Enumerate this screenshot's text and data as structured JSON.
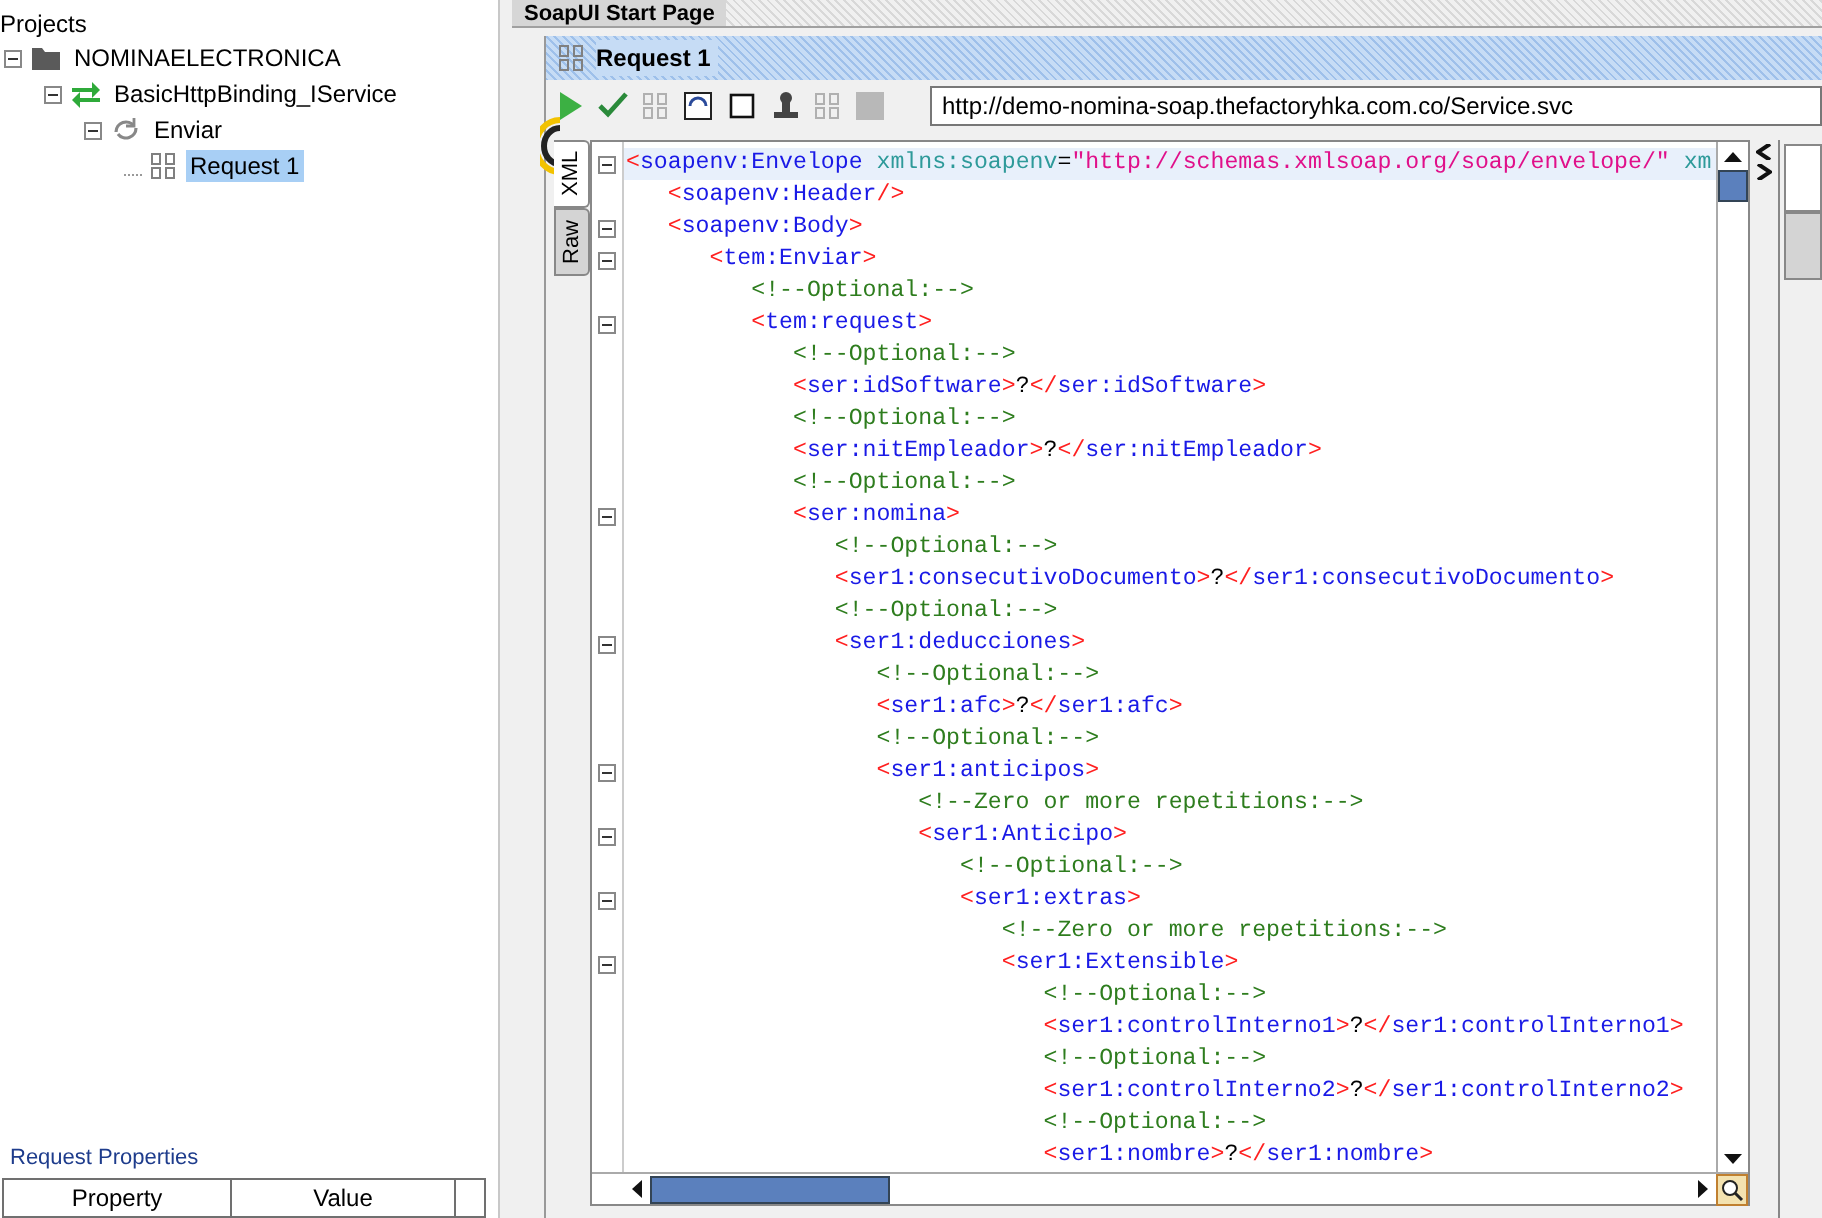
{
  "project_tree": {
    "title": "Projects",
    "items": [
      {
        "label": "NOMINAELECTRONICA",
        "kind": "project",
        "expanded": true,
        "selected": false,
        "children": [
          {
            "label": "BasicHttpBinding_IService",
            "kind": "interface",
            "expanded": true,
            "selected": false,
            "children": [
              {
                "label": "Enviar",
                "kind": "operation",
                "expanded": true,
                "selected": false,
                "children": [
                  {
                    "label": "Request 1",
                    "kind": "request",
                    "selected": true
                  }
                ]
              }
            ]
          }
        ]
      }
    ]
  },
  "request_properties": {
    "title": "Request Properties",
    "columns": [
      "Property",
      "Value"
    ]
  },
  "tabs": [
    {
      "label": "SoapUI Start Page",
      "selected": true
    }
  ],
  "request_window": {
    "title": "Request 1",
    "url": "http://demo-nomina-soap.thefactoryhka.com.co/Service.svc",
    "editor_tabs": [
      {
        "label": "XML",
        "selected": true
      },
      {
        "label": "Raw",
        "selected": false
      }
    ],
    "lines": [
      {
        "text": "<soapenv:Envelope xmlns:soapenv=\"http://schemas.xmlsoap.org/soap/envelope/\" xm",
        "foldable": true,
        "current": true
      },
      {
        "text": "   <soapenv:Header/>",
        "foldable": false,
        "current": false
      },
      {
        "text": "   <soapenv:Body>",
        "foldable": true,
        "current": false
      },
      {
        "text": "      <tem:Enviar>",
        "foldable": true,
        "current": false
      },
      {
        "text": "         <!--Optional:-->",
        "foldable": false,
        "current": false
      },
      {
        "text": "         <tem:request>",
        "foldable": true,
        "current": false
      },
      {
        "text": "            <!--Optional:-->",
        "foldable": false,
        "current": false
      },
      {
        "text": "            <ser:idSoftware>?</ser:idSoftware>",
        "foldable": false,
        "current": false
      },
      {
        "text": "            <!--Optional:-->",
        "foldable": false,
        "current": false
      },
      {
        "text": "            <ser:nitEmpleador>?</ser:nitEmpleador>",
        "foldable": false,
        "current": false
      },
      {
        "text": "            <!--Optional:-->",
        "foldable": false,
        "current": false
      },
      {
        "text": "            <ser:nomina>",
        "foldable": true,
        "current": false
      },
      {
        "text": "               <!--Optional:-->",
        "foldable": false,
        "current": false
      },
      {
        "text": "               <ser1:consecutivoDocumento>?</ser1:consecutivoDocumento>",
        "foldable": false,
        "current": false
      },
      {
        "text": "               <!--Optional:-->",
        "foldable": false,
        "current": false
      },
      {
        "text": "               <ser1:deducciones>",
        "foldable": true,
        "current": false
      },
      {
        "text": "                  <!--Optional:-->",
        "foldable": false,
        "current": false
      },
      {
        "text": "                  <ser1:afc>?</ser1:afc>",
        "foldable": false,
        "current": false
      },
      {
        "text": "                  <!--Optional:-->",
        "foldable": false,
        "current": false
      },
      {
        "text": "                  <ser1:anticipos>",
        "foldable": true,
        "current": false
      },
      {
        "text": "                     <!--Zero or more repetitions:-->",
        "foldable": false,
        "current": false
      },
      {
        "text": "                     <ser1:Anticipo>",
        "foldable": true,
        "current": false
      },
      {
        "text": "                        <!--Optional:-->",
        "foldable": false,
        "current": false
      },
      {
        "text": "                        <ser1:extras>",
        "foldable": true,
        "current": false
      },
      {
        "text": "                           <!--Zero or more repetitions:-->",
        "foldable": false,
        "current": false
      },
      {
        "text": "                           <ser1:Extensible>",
        "foldable": true,
        "current": false
      },
      {
        "text": "                              <!--Optional:-->",
        "foldable": false,
        "current": false
      },
      {
        "text": "                              <ser1:controlInterno1>?</ser1:controlInterno1>",
        "foldable": false,
        "current": false
      },
      {
        "text": "                              <!--Optional:-->",
        "foldable": false,
        "current": false
      },
      {
        "text": "                              <ser1:controlInterno2>?</ser1:controlInterno2>",
        "foldable": false,
        "current": false
      },
      {
        "text": "                              <!--Optional:-->",
        "foldable": false,
        "current": false
      },
      {
        "text": "                              <ser1:nombre>?</ser1:nombre>",
        "foldable": false,
        "current": false
      }
    ]
  }
}
